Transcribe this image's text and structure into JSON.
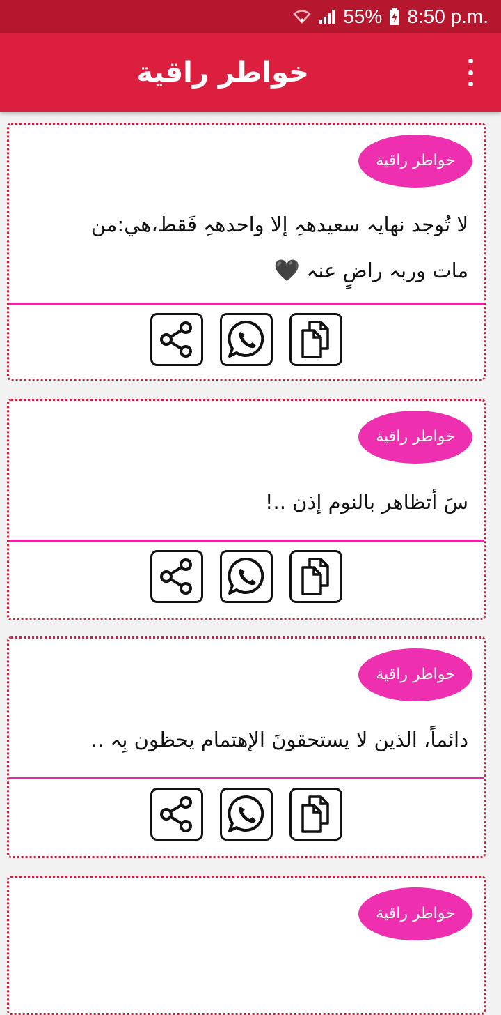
{
  "status_bar": {
    "battery": "55%",
    "time": "8:50 p.m."
  },
  "app_bar": {
    "title": "خواطر راقية"
  },
  "cards": [
    {
      "badge": "خواطر راقية",
      "lines": [
        "لا تُوجد نهايہ سعيدهہِ إلا واحدهہِ فَقط،هي:من",
        "مات وربہ راضٍ عنہ"
      ],
      "heart": "🖤"
    },
    {
      "badge": "خواطر راقية",
      "lines": [
        "سَ أتظاهر بالنوم إذن ..!"
      ],
      "heart": ""
    },
    {
      "badge": "خواطر راقية",
      "lines": [
        "دائماً، الذين لا يستحقونَ الإهتمام يحظون بِہ .."
      ],
      "heart": ""
    },
    {
      "badge": "خواطر راقية",
      "lines": [],
      "heart": ""
    }
  ],
  "icons": {
    "wifi": "wifi-icon",
    "signal": "signal-icon",
    "battery": "battery-charging-icon",
    "share": "share-icon",
    "whatsapp": "whatsapp-icon",
    "copy": "copy-icon",
    "menu": "more-vert-icon"
  },
  "colors": {
    "status_bar": "#b5172e",
    "app_bar": "#dc1f3e",
    "badge": "#ee2fb0",
    "card_border": "#c9243f",
    "divider": "#e6279f"
  }
}
